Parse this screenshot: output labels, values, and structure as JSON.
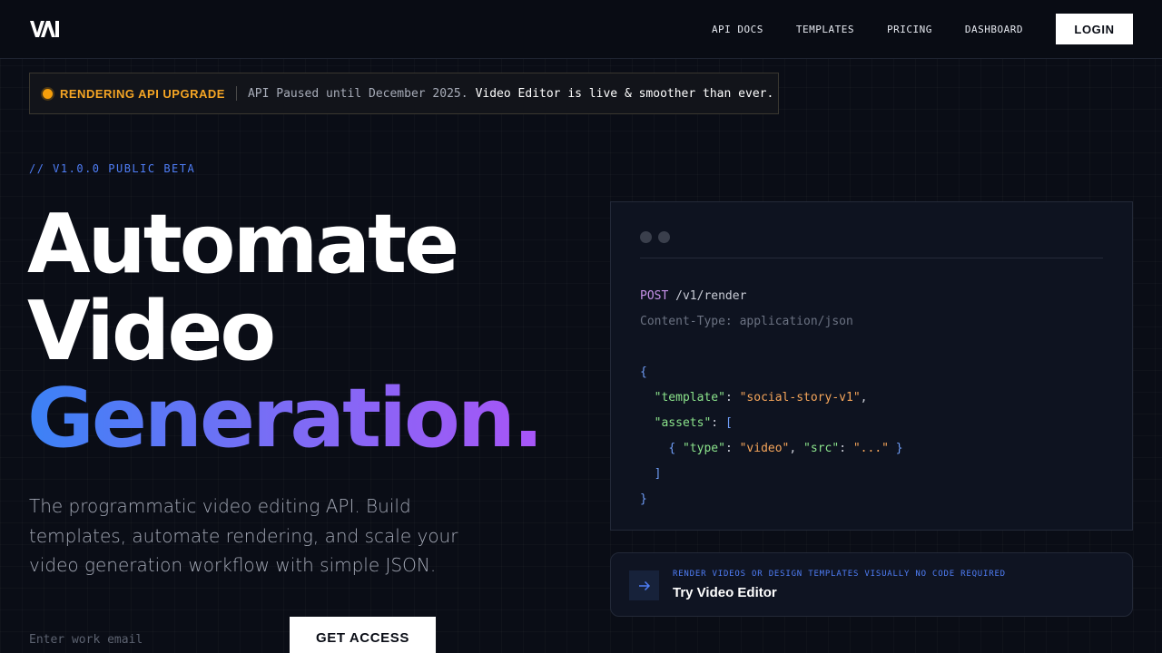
{
  "header": {
    "logo_text": "VAI",
    "nav": [
      "API DOCS",
      "TEMPLATES",
      "PRICING",
      "DASHBOARD"
    ],
    "login_label": "LOGIN"
  },
  "announcement": {
    "tag": "RENDERING API UPGRADE",
    "muted_text": "API Paused until December 2025.",
    "bright_text": "Video Editor is live & smoother than ever."
  },
  "hero": {
    "version": "// V1.0.0 PUBLIC BETA",
    "headline_line1": "Automate",
    "headline_line2": "Video",
    "headline_line3": "Generation.",
    "subtext": "The programmatic video editing API. Build templates, automate rendering, and scale your video generation workflow with simple JSON.",
    "email_placeholder": "Enter work email",
    "cta_label": "GET ACCESS"
  },
  "code_panel": {
    "method": "POST",
    "path": " /v1/render",
    "content_type": "Content-Type: application/json",
    "template_key": "\"template\"",
    "template_value": "\"social-story-v1\"",
    "assets_key": "\"assets\"",
    "type_key": "\"type\"",
    "type_value": "\"video\"",
    "src_key": "\"src\"",
    "src_value": "\"...\""
  },
  "editor_card": {
    "kicker": "RENDER VIDEOS OR DESIGN TEMPLATES VISUALLY NO CODE REQUIRED",
    "title": "Try Video Editor"
  },
  "colors": {
    "background": "#0a0d16",
    "accent_blue": "#4f7ef7",
    "accent_purple": "#a855f7",
    "amber": "#f5a524"
  },
  "icons": [
    "logo-mark",
    "status-dot-icon",
    "arrow-right-icon"
  ]
}
